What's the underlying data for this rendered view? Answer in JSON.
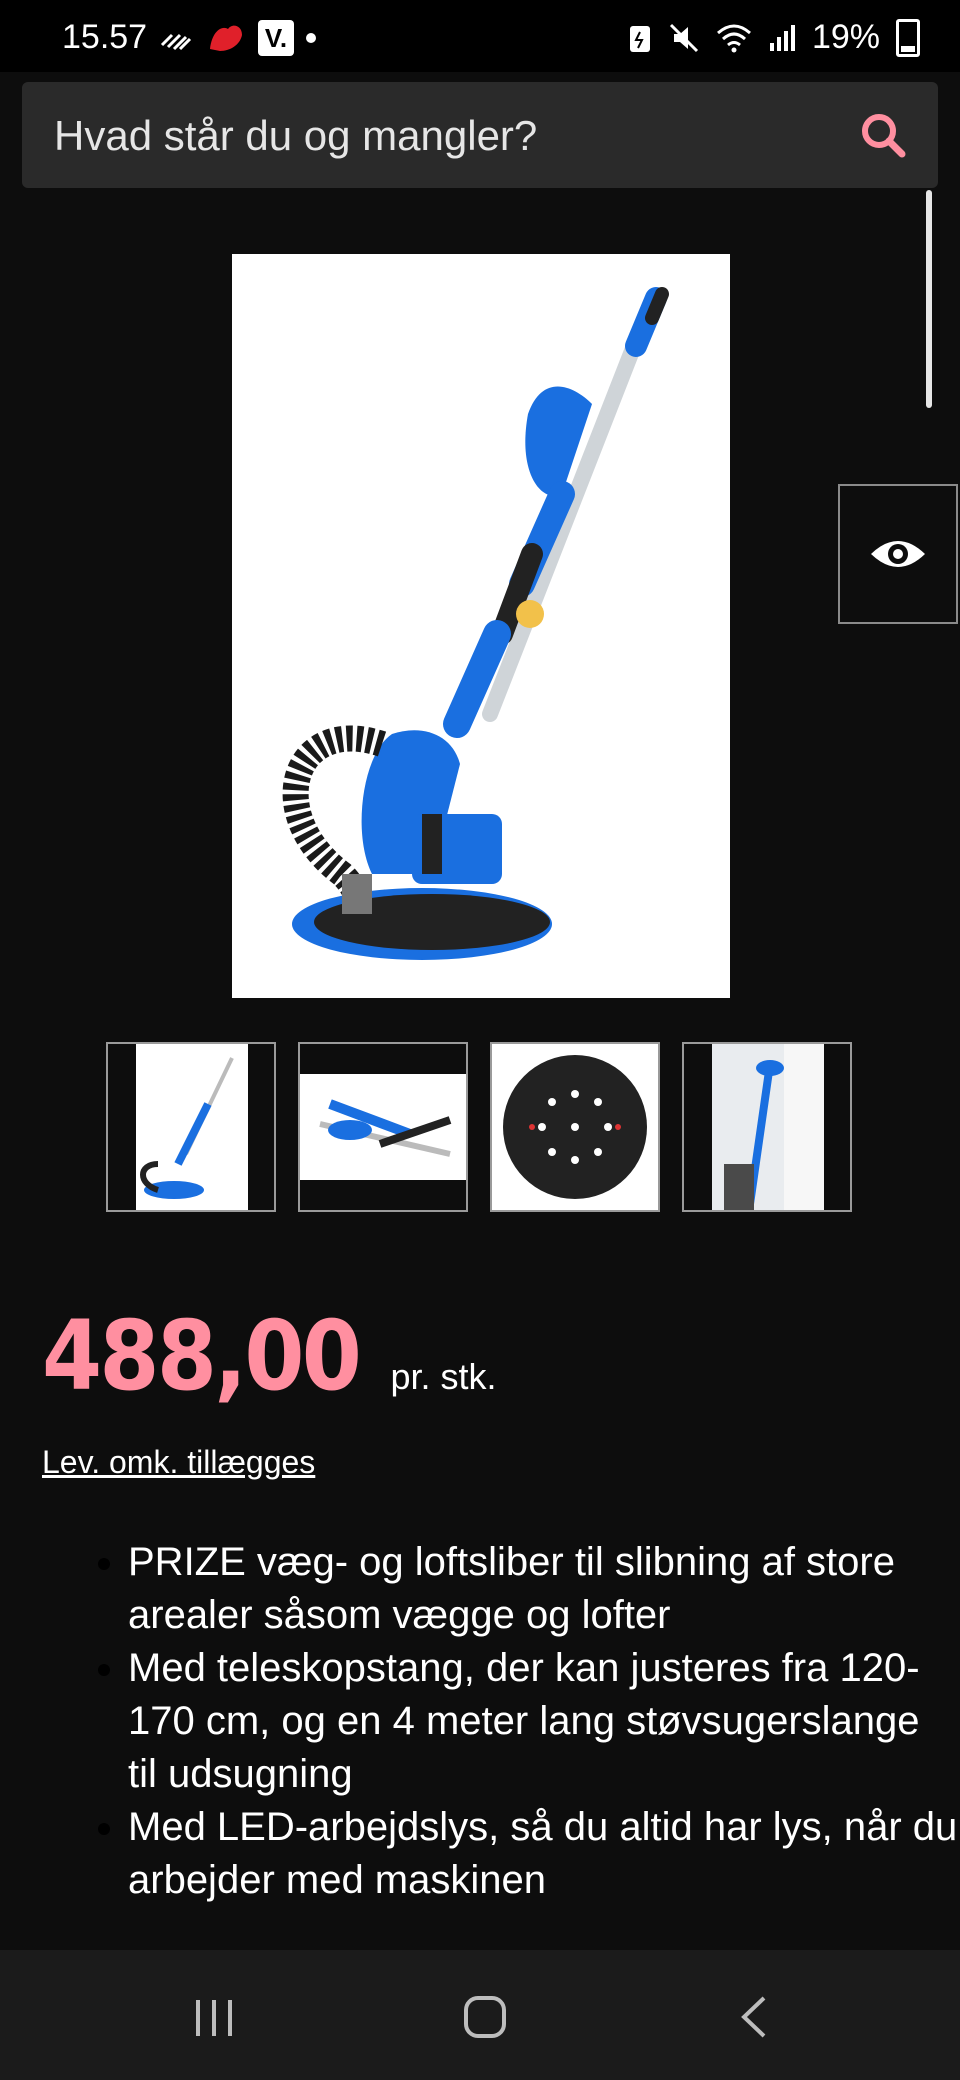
{
  "status_bar": {
    "time": "15.57",
    "battery": "19%",
    "badge_letter": "V."
  },
  "search": {
    "placeholder": "Hvad står du og mangler?"
  },
  "product": {
    "price": "488,00",
    "price_unit": "pr. stk.",
    "delivery_note": "Lev. omk. tillægges",
    "features": [
      "PRIZE væg- og loftsliber til slibning af store arealer såsom vægge og lofter",
      "Med teleskopstang, der kan justeres fra 120-170 cm, og en 4 meter lang støvsugerslange til udsugning",
      "Med LED-arbejdslys, så du altid har lys, når du arbejder med maskinen"
    ]
  },
  "colors": {
    "price_accent": "#ff8fa0",
    "search_icon": "#ff8fa0",
    "tool_blue": "#1a6fe0"
  },
  "icons": [
    "search-icon",
    "eye-icon",
    "recent-apps-icon",
    "home-icon",
    "back-icon"
  ]
}
